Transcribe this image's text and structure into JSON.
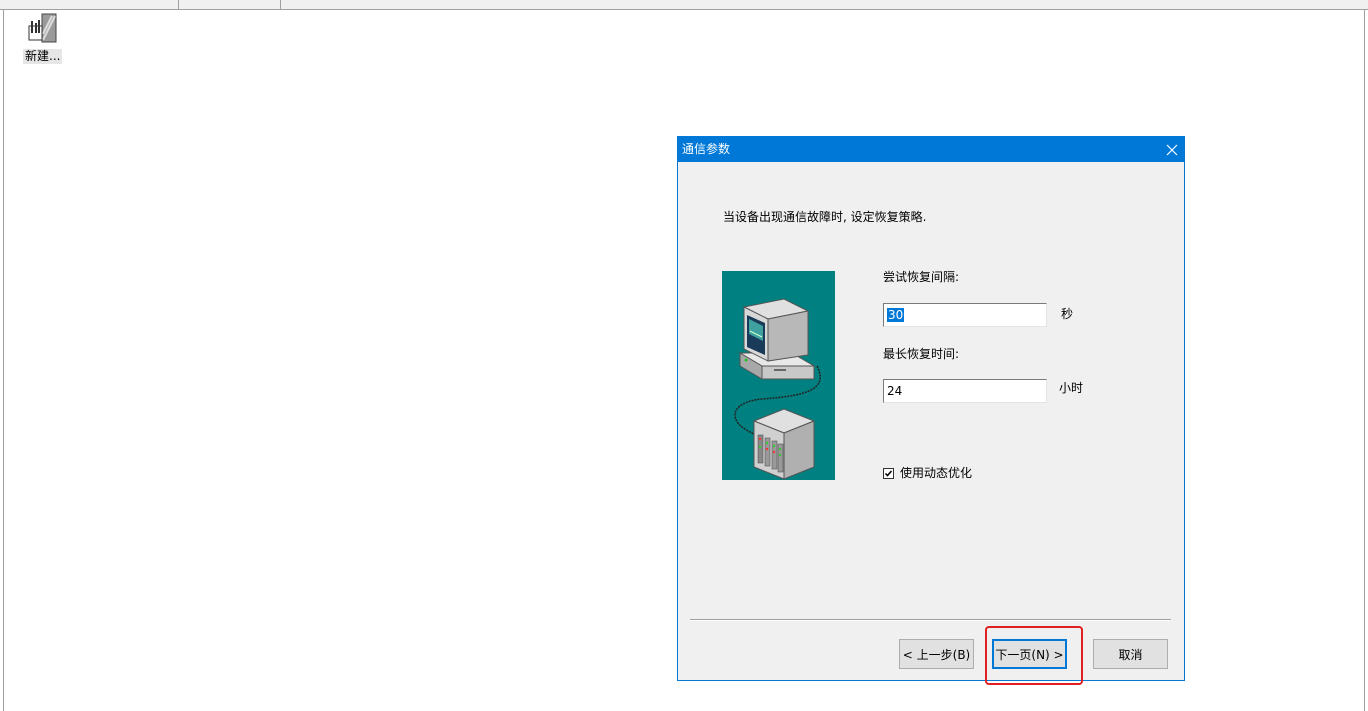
{
  "desktop": {
    "icon_name": "new-project-icon",
    "icon_label": "新建..."
  },
  "dialog": {
    "title": "通信参数",
    "prompt": "当设备出现通信故障时, 设定恢复策略.",
    "retry_interval": {
      "label": "尝试恢复间隔:",
      "value": "30",
      "unit": "秒"
    },
    "max_recovery": {
      "label": "最长恢复时间:",
      "value": "24",
      "unit": "小时"
    },
    "dynamic_optimization": {
      "label": "使用动态优化",
      "checked": true
    },
    "buttons": {
      "back": "< 上一步(B)",
      "next": "下一页(N) >",
      "cancel": "取消"
    }
  },
  "colors": {
    "title_bar": "#0078d7",
    "illustration_bg": "#008080",
    "highlight_box": "#e02020"
  }
}
